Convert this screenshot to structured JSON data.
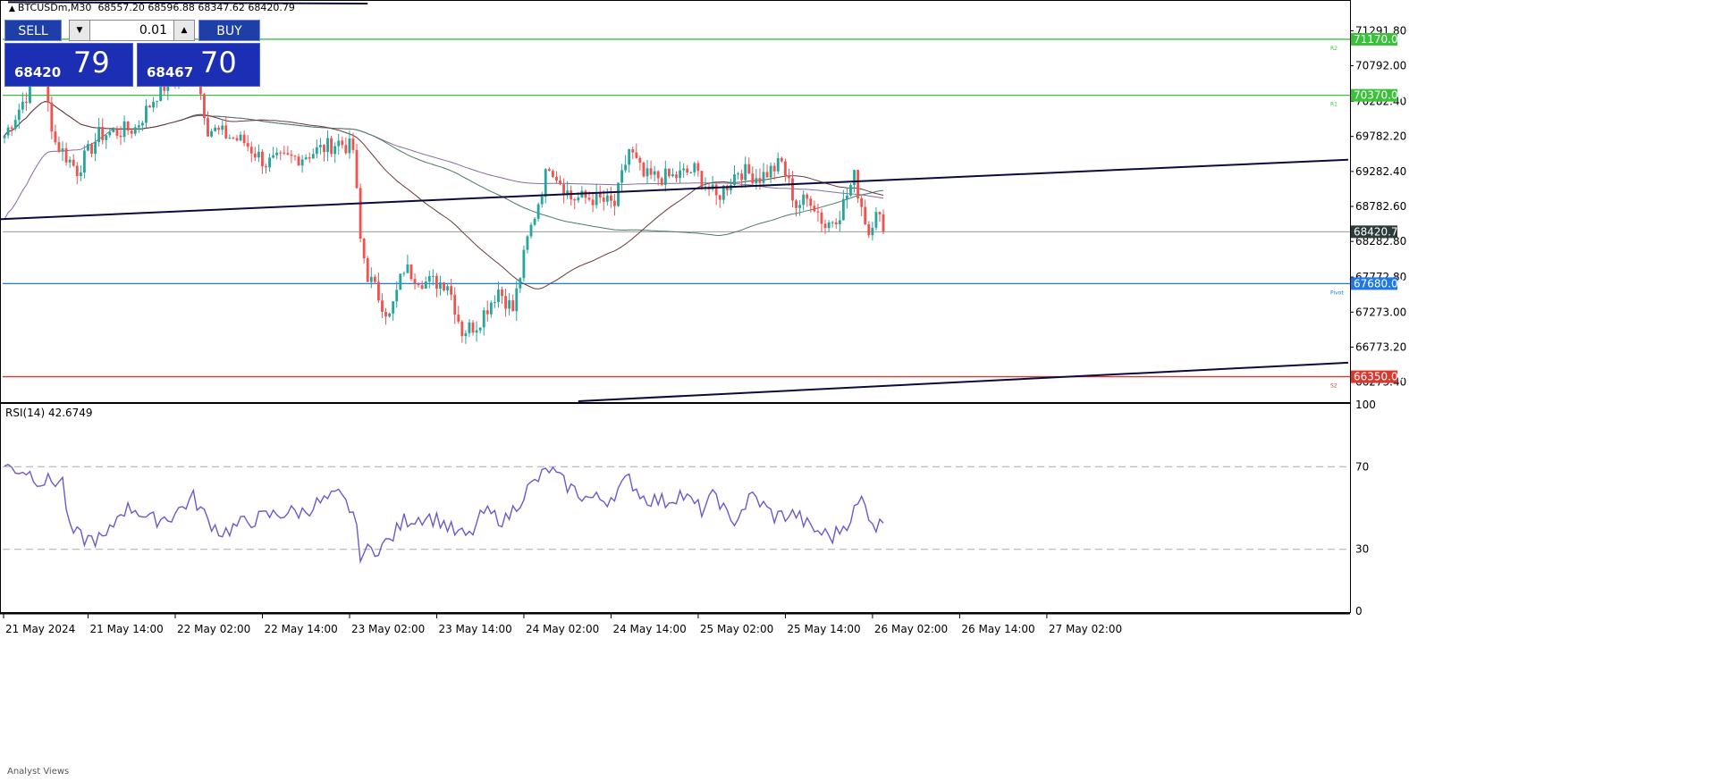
{
  "header": {
    "symbol": "BTCUSDm,M30",
    "ohlc": "68557.20 68596.88 68347.62 68420.79"
  },
  "trade_panel": {
    "sell_label": "SELL",
    "buy_label": "BUY",
    "lot": "0.01",
    "sell_small": "68420",
    "sell_big": "79",
    "buy_small": "68467",
    "buy_big": "70"
  },
  "footer": {
    "label": "Analyst Views"
  },
  "colors": {
    "bull": "#26a69a",
    "bear": "#ef5350",
    "green_level": "#3cc13c",
    "blue_level": "#1e78e6",
    "red_level": "#d9382e",
    "trendline": "#0b0b3b",
    "rsi": "#6a5acd",
    "ma_dark": "#6b3a3a",
    "ma_green": "#4e7a6a",
    "ma_purple": "#8a6aa0"
  },
  "chart_data": [
    {
      "type": "candlestick",
      "title": "",
      "ylim": [
        66000,
        71680
      ],
      "y_ticks": [
        "71291.80",
        "70792.00",
        "70282.40",
        "69782.20",
        "69282.40",
        "68782.60",
        "68282.80",
        "67772.80",
        "67273.00",
        "66773.20",
        "66273.40"
      ],
      "x_ticks": [
        "21 May 2024",
        "21 May 14:00",
        "22 May 02:00",
        "22 May 14:00",
        "23 May 02:00",
        "23 May 14:00",
        "24 May 02:00",
        "24 May 14:00",
        "25 May 02:00",
        "25 May 14:00",
        "26 May 02:00",
        "26 May 14:00",
        "27 May 02:00"
      ],
      "anchors": [
        {
          "x": 0,
          "price": 69800
        },
        {
          "x": 10,
          "price": 70750
        },
        {
          "x": 14,
          "price": 69700
        },
        {
          "x": 20,
          "price": 69300
        },
        {
          "x": 26,
          "price": 69800
        },
        {
          "x": 36,
          "price": 69900
        },
        {
          "x": 42,
          "price": 70400
        },
        {
          "x": 52,
          "price": 70900
        },
        {
          "x": 56,
          "price": 69900
        },
        {
          "x": 66,
          "price": 69700
        },
        {
          "x": 72,
          "price": 69400
        },
        {
          "x": 82,
          "price": 69500
        },
        {
          "x": 92,
          "price": 69700
        },
        {
          "x": 96,
          "price": 69600
        },
        {
          "x": 98,
          "price": 68300
        },
        {
          "x": 100,
          "price": 67800
        },
        {
          "x": 106,
          "price": 67200
        },
        {
          "x": 110,
          "price": 67900
        },
        {
          "x": 116,
          "price": 67700
        },
        {
          "x": 122,
          "price": 67700
        },
        {
          "x": 126,
          "price": 67000
        },
        {
          "x": 130,
          "price": 67100
        },
        {
          "x": 136,
          "price": 67600
        },
        {
          "x": 140,
          "price": 67300
        },
        {
          "x": 144,
          "price": 68300
        },
        {
          "x": 150,
          "price": 69400
        },
        {
          "x": 156,
          "price": 68900
        },
        {
          "x": 162,
          "price": 68900
        },
        {
          "x": 168,
          "price": 68800
        },
        {
          "x": 172,
          "price": 69600
        },
        {
          "x": 176,
          "price": 69200
        },
        {
          "x": 184,
          "price": 69200
        },
        {
          "x": 190,
          "price": 69300
        },
        {
          "x": 196,
          "price": 68900
        },
        {
          "x": 202,
          "price": 69300
        },
        {
          "x": 208,
          "price": 69200
        },
        {
          "x": 214,
          "price": 69400
        },
        {
          "x": 218,
          "price": 68800
        },
        {
          "x": 222,
          "price": 68900
        },
        {
          "x": 226,
          "price": 68500
        },
        {
          "x": 230,
          "price": 68700
        },
        {
          "x": 234,
          "price": 69200
        },
        {
          "x": 238,
          "price": 68400
        },
        {
          "x": 240,
          "price": 68800
        },
        {
          "x": 242,
          "price": 68420
        }
      ],
      "current_price": "68420.79",
      "levels": [
        {
          "price": 71170.0,
          "label": "71170.00",
          "color": "#3cc13c",
          "tag": "R2"
        },
        {
          "price": 70370.0,
          "label": "70370.00",
          "color": "#3cc13c",
          "tag": "R1"
        },
        {
          "price": 67680.0,
          "label": "67680.00",
          "color": "#1e78e6",
          "tag": "Pivot"
        },
        {
          "price": 66350.0,
          "label": "66350.00",
          "color": "#d9382e",
          "tag": "S2"
        }
      ],
      "trendlines": [
        {
          "x1": -1,
          "p1": 68600,
          "x2": 370,
          "p2": 69450
        },
        {
          "x1": 158,
          "p1": 66000,
          "x2": 370,
          "p2": 66550
        },
        {
          "x1": 1,
          "p1": 71700,
          "x2": 100,
          "p2": 71680
        }
      ]
    },
    {
      "type": "line",
      "title": "RSI(14) 42.6749",
      "ylim": [
        0,
        100
      ],
      "y_ticks": [
        "100",
        "70",
        "30",
        "0"
      ],
      "levels": [
        70,
        30
      ],
      "anchors": [
        {
          "x": 0,
          "v": 70
        },
        {
          "x": 6,
          "v": 68
        },
        {
          "x": 10,
          "v": 63
        },
        {
          "x": 16,
          "v": 63
        },
        {
          "x": 18,
          "v": 39
        },
        {
          "x": 22,
          "v": 35
        },
        {
          "x": 28,
          "v": 35
        },
        {
          "x": 32,
          "v": 49
        },
        {
          "x": 36,
          "v": 50
        },
        {
          "x": 40,
          "v": 44
        },
        {
          "x": 46,
          "v": 46
        },
        {
          "x": 52,
          "v": 55
        },
        {
          "x": 56,
          "v": 44
        },
        {
          "x": 60,
          "v": 38
        },
        {
          "x": 66,
          "v": 43
        },
        {
          "x": 72,
          "v": 46
        },
        {
          "x": 78,
          "v": 48
        },
        {
          "x": 82,
          "v": 48
        },
        {
          "x": 86,
          "v": 52
        },
        {
          "x": 92,
          "v": 56
        },
        {
          "x": 96,
          "v": 48
        },
        {
          "x": 98,
          "v": 28
        },
        {
          "x": 102,
          "v": 30
        },
        {
          "x": 106,
          "v": 34
        },
        {
          "x": 110,
          "v": 44
        },
        {
          "x": 116,
          "v": 46
        },
        {
          "x": 120,
          "v": 44
        },
        {
          "x": 124,
          "v": 38
        },
        {
          "x": 128,
          "v": 36
        },
        {
          "x": 132,
          "v": 48
        },
        {
          "x": 138,
          "v": 44
        },
        {
          "x": 144,
          "v": 59
        },
        {
          "x": 150,
          "v": 69
        },
        {
          "x": 154,
          "v": 62
        },
        {
          "x": 160,
          "v": 55
        },
        {
          "x": 166,
          "v": 54
        },
        {
          "x": 172,
          "v": 64
        },
        {
          "x": 176,
          "v": 55
        },
        {
          "x": 182,
          "v": 53
        },
        {
          "x": 186,
          "v": 57
        },
        {
          "x": 192,
          "v": 49
        },
        {
          "x": 196,
          "v": 57
        },
        {
          "x": 200,
          "v": 42
        },
        {
          "x": 206,
          "v": 56
        },
        {
          "x": 212,
          "v": 46
        },
        {
          "x": 218,
          "v": 47
        },
        {
          "x": 222,
          "v": 40
        },
        {
          "x": 228,
          "v": 36
        },
        {
          "x": 232,
          "v": 43
        },
        {
          "x": 236,
          "v": 54
        },
        {
          "x": 240,
          "v": 41
        },
        {
          "x": 242,
          "v": 42.67
        }
      ]
    }
  ]
}
